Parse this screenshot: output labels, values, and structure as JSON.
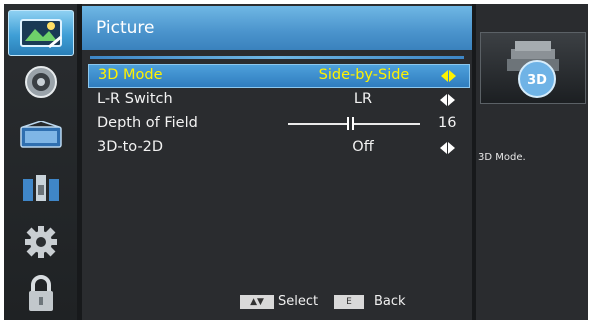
{
  "sidebar": {
    "icons": [
      {
        "name": "picture-icon",
        "selected": true
      },
      {
        "name": "sound-icon",
        "selected": false
      },
      {
        "name": "channel-icon",
        "selected": false
      },
      {
        "name": "setup-icon",
        "selected": false
      },
      {
        "name": "settings-gear-icon",
        "selected": false
      },
      {
        "name": "lock-icon",
        "selected": false
      }
    ]
  },
  "header": {
    "title": "Picture"
  },
  "menu": {
    "items": [
      {
        "label": "3D Mode",
        "value": "Side-by-Side",
        "selected": true
      },
      {
        "label": "L-R Switch",
        "value": "LR",
        "selected": false
      },
      {
        "label": "Depth of Field",
        "value": "16",
        "selected": false
      },
      {
        "label": "3D-to-2D",
        "value": "Off",
        "selected": false
      }
    ]
  },
  "footer": {
    "select_key": "▲▼",
    "select_label": "Select",
    "back_key": "E",
    "back_label": "Back"
  },
  "help": {
    "text": "3D Mode."
  },
  "colors": {
    "accent": "#3f8fd0",
    "selected_text": "#fff200",
    "background": "#2a2c2f"
  }
}
